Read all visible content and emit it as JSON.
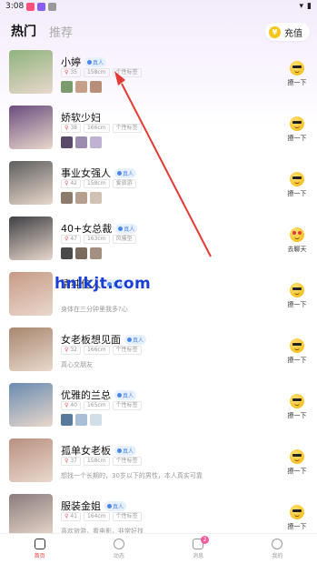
{
  "status_bar": {
    "time": "3:08"
  },
  "header": {
    "tabs": [
      {
        "label": "热门",
        "active": true
      },
      {
        "label": "推荐",
        "active": false
      }
    ],
    "recharge_label": "充值"
  },
  "users": [
    {
      "name": "小婷",
      "badge": "真人",
      "age": "35",
      "height": "158cm",
      "tag": "个性标签",
      "desc": "",
      "thumbs": [
        "#7a9c6d",
        "#c7a08a",
        "#b88d7a"
      ],
      "action": "撩一下",
      "emoji": "cool",
      "avatar": "#8fb37d"
    },
    {
      "name": "娇软少妇",
      "badge": "",
      "age": "38",
      "height": "166cm",
      "tag": "个性标签",
      "desc": "",
      "thumbs": [
        "#5a4a6a",
        "#9c8cb0",
        "#c0b3d1"
      ],
      "action": "撩一下",
      "emoji": "cool",
      "avatar": "#6b4d7e"
    },
    {
      "name": "事业女强人",
      "badge": "真人",
      "age": "42",
      "height": "158cm",
      "tag": "爱旅游",
      "desc": "",
      "thumbs": [
        "#8c7a6a",
        "#b5a08e",
        "#d1c2b3"
      ],
      "action": "撩一下",
      "emoji": "cool",
      "avatar": "#5e5e5e"
    },
    {
      "name": "40+女总裁",
      "badge": "真人",
      "age": "47",
      "height": "163cm",
      "tag": "风骚型",
      "desc": "",
      "thumbs": [
        "#4a4a4a",
        "#7b6b5e",
        "#a39080"
      ],
      "action": "去聊天",
      "emoji": "love",
      "avatar": "#3f3f45"
    },
    {
      "name": "清纯佳人",
      "badge": "真人",
      "age": "",
      "height": "",
      "tag": "",
      "desc": "身体在三分钟里我多?心",
      "thumbs": [],
      "action": "撩一下",
      "emoji": "cool",
      "avatar": "#c79a86"
    },
    {
      "name": "女老板想见面",
      "badge": "真人",
      "age": "32",
      "height": "166cm",
      "tag": "个性标签",
      "desc": "真心交朋友",
      "thumbs": [],
      "action": "撩一下",
      "emoji": "cool",
      "avatar": "#a7876f"
    },
    {
      "name": "优雅的兰总",
      "badge": "真人",
      "age": "40",
      "height": "165cm",
      "tag": "个性标签",
      "desc": "",
      "thumbs": [
        "#5a7a9c",
        "#a8c0d6",
        "#d1dfe9"
      ],
      "action": "撩一下",
      "emoji": "cool",
      "avatar": "#6a8bb0"
    },
    {
      "name": "孤单女老板",
      "badge": "真人",
      "age": "37",
      "height": "158cm",
      "tag": "个性标签",
      "desc": "想找一个长期的，30岁以下的男性，本人真实可靠",
      "thumbs": [],
      "action": "撩一下",
      "emoji": "cool",
      "avatar": "#b89080"
    },
    {
      "name": "服装金姐",
      "badge": "真人",
      "age": "41",
      "height": "164cm",
      "tag": "个性标签",
      "desc": "喜欢旅游，看电影，非常好找",
      "thumbs": [],
      "action": "撩一下",
      "emoji": "cool",
      "avatar": "#8a7c7c"
    }
  ],
  "watermark": "hnlkjt.com",
  "bottom_nav": [
    {
      "label": "首页",
      "active": true,
      "badge": ""
    },
    {
      "label": "动态",
      "active": false,
      "badge": ""
    },
    {
      "label": "消息",
      "active": false,
      "badge": "2"
    },
    {
      "label": "我的",
      "active": false,
      "badge": ""
    }
  ],
  "colors": {
    "accent": "#e53935",
    "badge_blue": "#4a86e8",
    "arrow": "#e53935",
    "watermark": "#1a3fd6"
  }
}
